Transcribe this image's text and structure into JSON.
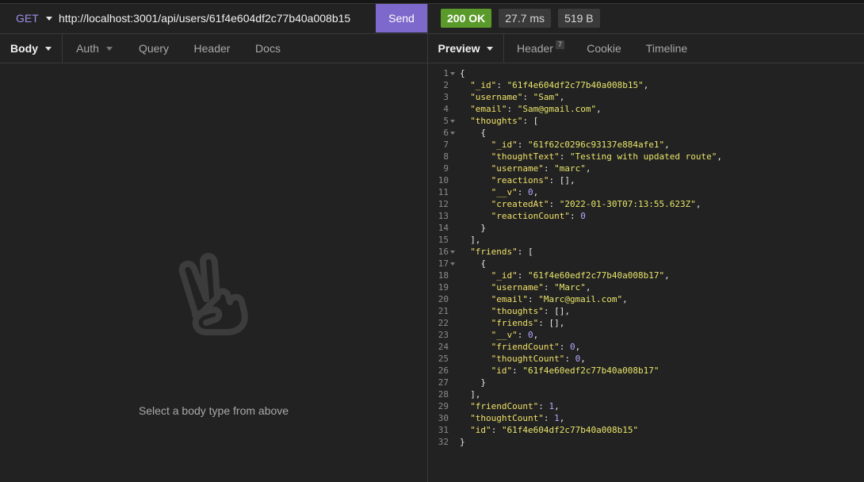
{
  "request": {
    "method": "GET",
    "url": "http://localhost:3001/api/users/61f4e604df2c77b40a008b15",
    "send_label": "Send",
    "tabs": [
      {
        "label": "Body",
        "active": true,
        "dropdown": true
      },
      {
        "label": "Auth",
        "active": false,
        "dropdown": true
      },
      {
        "label": "Query",
        "active": false
      },
      {
        "label": "Header",
        "active": false
      },
      {
        "label": "Docs",
        "active": false
      }
    ],
    "empty_icon": "peace-hand-icon",
    "empty_text": "Select a body type from above"
  },
  "response": {
    "status": "200 OK",
    "time": "27.7 ms",
    "size": "519 B",
    "tabs": [
      {
        "label": "Preview",
        "active": true,
        "dropdown": true
      },
      {
        "label": "Header",
        "active": false,
        "count": "7"
      },
      {
        "label": "Cookie",
        "active": false
      },
      {
        "label": "Timeline",
        "active": false
      }
    ],
    "lines": [
      {
        "n": "1",
        "fold": true,
        "indent": 0,
        "parts": [
          [
            "p",
            "{"
          ]
        ]
      },
      {
        "n": "2",
        "indent": 2,
        "parts": [
          [
            "k",
            "\"_id\""
          ],
          [
            "p",
            ": "
          ],
          [
            "s",
            "\"61f4e604df2c77b40a008b15\""
          ],
          [
            "p",
            ","
          ]
        ]
      },
      {
        "n": "3",
        "indent": 2,
        "parts": [
          [
            "k",
            "\"username\""
          ],
          [
            "p",
            ": "
          ],
          [
            "s",
            "\"Sam\""
          ],
          [
            "p",
            ","
          ]
        ]
      },
      {
        "n": "4",
        "indent": 2,
        "parts": [
          [
            "k",
            "\"email\""
          ],
          [
            "p",
            ": "
          ],
          [
            "s",
            "\"Sam@gmail.com\""
          ],
          [
            "p",
            ","
          ]
        ]
      },
      {
        "n": "5",
        "fold": true,
        "indent": 2,
        "parts": [
          [
            "k",
            "\"thoughts\""
          ],
          [
            "p",
            ": ["
          ]
        ]
      },
      {
        "n": "6",
        "fold": true,
        "indent": 4,
        "parts": [
          [
            "p",
            "{"
          ]
        ]
      },
      {
        "n": "7",
        "indent": 6,
        "parts": [
          [
            "k",
            "\"_id\""
          ],
          [
            "p",
            ": "
          ],
          [
            "s",
            "\"61f62c0296c93137e884afe1\""
          ],
          [
            "p",
            ","
          ]
        ]
      },
      {
        "n": "8",
        "indent": 6,
        "parts": [
          [
            "k",
            "\"thoughtText\""
          ],
          [
            "p",
            ": "
          ],
          [
            "s",
            "\"Testing with updated route\""
          ],
          [
            "p",
            ","
          ]
        ]
      },
      {
        "n": "9",
        "indent": 6,
        "parts": [
          [
            "k",
            "\"username\""
          ],
          [
            "p",
            ": "
          ],
          [
            "s",
            "\"marc\""
          ],
          [
            "p",
            ","
          ]
        ]
      },
      {
        "n": "10",
        "indent": 6,
        "parts": [
          [
            "k",
            "\"reactions\""
          ],
          [
            "p",
            ": [],"
          ]
        ]
      },
      {
        "n": "11",
        "indent": 6,
        "parts": [
          [
            "k",
            "\"__v\""
          ],
          [
            "p",
            ": "
          ],
          [
            "n",
            "0"
          ],
          [
            "p",
            ","
          ]
        ]
      },
      {
        "n": "12",
        "indent": 6,
        "parts": [
          [
            "k",
            "\"createdAt\""
          ],
          [
            "p",
            ": "
          ],
          [
            "s",
            "\"2022-01-30T07:13:55.623Z\""
          ],
          [
            "p",
            ","
          ]
        ]
      },
      {
        "n": "13",
        "indent": 6,
        "parts": [
          [
            "k",
            "\"reactionCount\""
          ],
          [
            "p",
            ": "
          ],
          [
            "n",
            "0"
          ]
        ]
      },
      {
        "n": "14",
        "indent": 4,
        "parts": [
          [
            "p",
            "}"
          ]
        ]
      },
      {
        "n": "15",
        "indent": 2,
        "parts": [
          [
            "p",
            "],"
          ]
        ]
      },
      {
        "n": "16",
        "fold": true,
        "indent": 2,
        "parts": [
          [
            "k",
            "\"friends\""
          ],
          [
            "p",
            ": ["
          ]
        ]
      },
      {
        "n": "17",
        "fold": true,
        "indent": 4,
        "parts": [
          [
            "p",
            "{"
          ]
        ]
      },
      {
        "n": "18",
        "indent": 6,
        "parts": [
          [
            "k",
            "\"_id\""
          ],
          [
            "p",
            ": "
          ],
          [
            "s",
            "\"61f4e60edf2c77b40a008b17\""
          ],
          [
            "p",
            ","
          ]
        ]
      },
      {
        "n": "19",
        "indent": 6,
        "parts": [
          [
            "k",
            "\"username\""
          ],
          [
            "p",
            ": "
          ],
          [
            "s",
            "\"Marc\""
          ],
          [
            "p",
            ","
          ]
        ]
      },
      {
        "n": "20",
        "indent": 6,
        "parts": [
          [
            "k",
            "\"email\""
          ],
          [
            "p",
            ": "
          ],
          [
            "s",
            "\"Marc@gmail.com\""
          ],
          [
            "p",
            ","
          ]
        ]
      },
      {
        "n": "21",
        "indent": 6,
        "parts": [
          [
            "k",
            "\"thoughts\""
          ],
          [
            "p",
            ": [],"
          ]
        ]
      },
      {
        "n": "22",
        "indent": 6,
        "parts": [
          [
            "k",
            "\"friends\""
          ],
          [
            "p",
            ": [],"
          ]
        ]
      },
      {
        "n": "23",
        "indent": 6,
        "parts": [
          [
            "k",
            "\"__v\""
          ],
          [
            "p",
            ": "
          ],
          [
            "n",
            "0"
          ],
          [
            "p",
            ","
          ]
        ]
      },
      {
        "n": "24",
        "indent": 6,
        "parts": [
          [
            "k",
            "\"friendCount\""
          ],
          [
            "p",
            ": "
          ],
          [
            "n",
            "0"
          ],
          [
            "p",
            ","
          ]
        ]
      },
      {
        "n": "25",
        "indent": 6,
        "parts": [
          [
            "k",
            "\"thoughtCount\""
          ],
          [
            "p",
            ": "
          ],
          [
            "n",
            "0"
          ],
          [
            "p",
            ","
          ]
        ]
      },
      {
        "n": "26",
        "indent": 6,
        "parts": [
          [
            "k",
            "\"id\""
          ],
          [
            "p",
            ": "
          ],
          [
            "s",
            "\"61f4e60edf2c77b40a008b17\""
          ]
        ]
      },
      {
        "n": "27",
        "indent": 4,
        "parts": [
          [
            "p",
            "}"
          ]
        ]
      },
      {
        "n": "28",
        "indent": 2,
        "parts": [
          [
            "p",
            "],"
          ]
        ]
      },
      {
        "n": "29",
        "indent": 2,
        "parts": [
          [
            "k",
            "\"friendCount\""
          ],
          [
            "p",
            ": "
          ],
          [
            "n",
            "1"
          ],
          [
            "p",
            ","
          ]
        ]
      },
      {
        "n": "30",
        "indent": 2,
        "parts": [
          [
            "k",
            "\"thoughtCount\""
          ],
          [
            "p",
            ": "
          ],
          [
            "n",
            "1"
          ],
          [
            "p",
            ","
          ]
        ]
      },
      {
        "n": "31",
        "indent": 2,
        "parts": [
          [
            "k",
            "\"id\""
          ],
          [
            "p",
            ": "
          ],
          [
            "s",
            "\"61f4e604df2c77b40a008b15\""
          ]
        ]
      },
      {
        "n": "32",
        "indent": 0,
        "parts": [
          [
            "p",
            "}"
          ]
        ]
      }
    ]
  }
}
